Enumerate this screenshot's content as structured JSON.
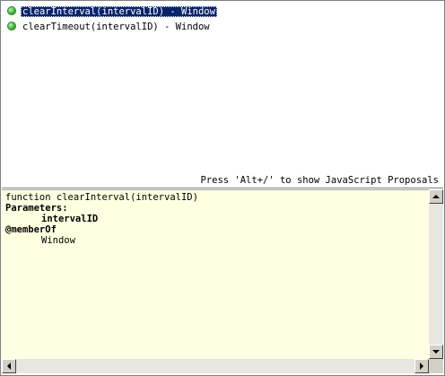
{
  "proposals": [
    {
      "label": "clearInterval(intervalID) - Window",
      "selected": true,
      "icon": "green-circle-icon"
    },
    {
      "label": "clearTimeout(intervalID) - Window",
      "selected": false,
      "icon": "green-circle-icon"
    }
  ],
  "status": {
    "hint": "Press 'Alt+/' to show JavaScript Proposals"
  },
  "info": {
    "signature": "function clearInterval(intervalID)",
    "params_heading": "Parameters:",
    "param_name": "intervalID",
    "member_heading": "@memberOf",
    "member_value": "Window"
  },
  "colors": {
    "selection_bg": "#0a246a",
    "info_bg": "#ffffe1",
    "icon_green": "#3fae3c"
  }
}
